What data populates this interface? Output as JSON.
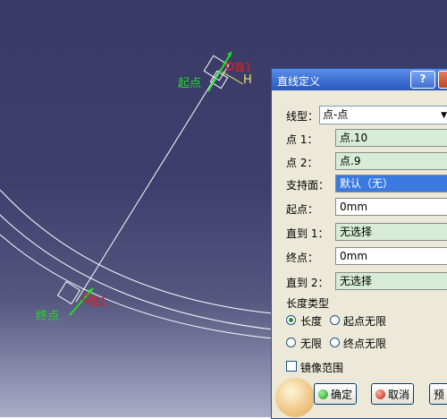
{
  "viewport": {
    "start_label": "起点",
    "end_label": "终点",
    "marker_top": "直1",
    "marker_bottom": "直1",
    "h_label": "H",
    "colors": {
      "bg_top": "#3a3a66",
      "bg_bottom": "#a9abc7",
      "label_green": "#22dd22",
      "marker_red": "#dd2222"
    }
  },
  "dialog": {
    "title": "直线定义",
    "help_label": "?",
    "line_type": {
      "label": "线型：",
      "value": "点-点"
    },
    "point1": {
      "label": "点 1：",
      "value": "点.10"
    },
    "point2": {
      "label": "点 2：",
      "value": "点.9"
    },
    "support": {
      "label": "支持面：",
      "value": "默认（无）"
    },
    "start": {
      "label": "起点：",
      "value": "0mm"
    },
    "up_to1": {
      "label": "直到 1：",
      "value": "无选择"
    },
    "end": {
      "label": "终点：",
      "value": "0mm"
    },
    "up_to2": {
      "label": "直到 2：",
      "value": "无选择"
    },
    "length_type": {
      "label": "长度类型",
      "options": [
        "长度",
        "起点无限",
        "无限",
        "终点无限"
      ],
      "selected": "长度"
    },
    "mirror_label": "镜像范围",
    "ok_label": "确定",
    "cancel_label": "取消",
    "preview_label": "预"
  }
}
